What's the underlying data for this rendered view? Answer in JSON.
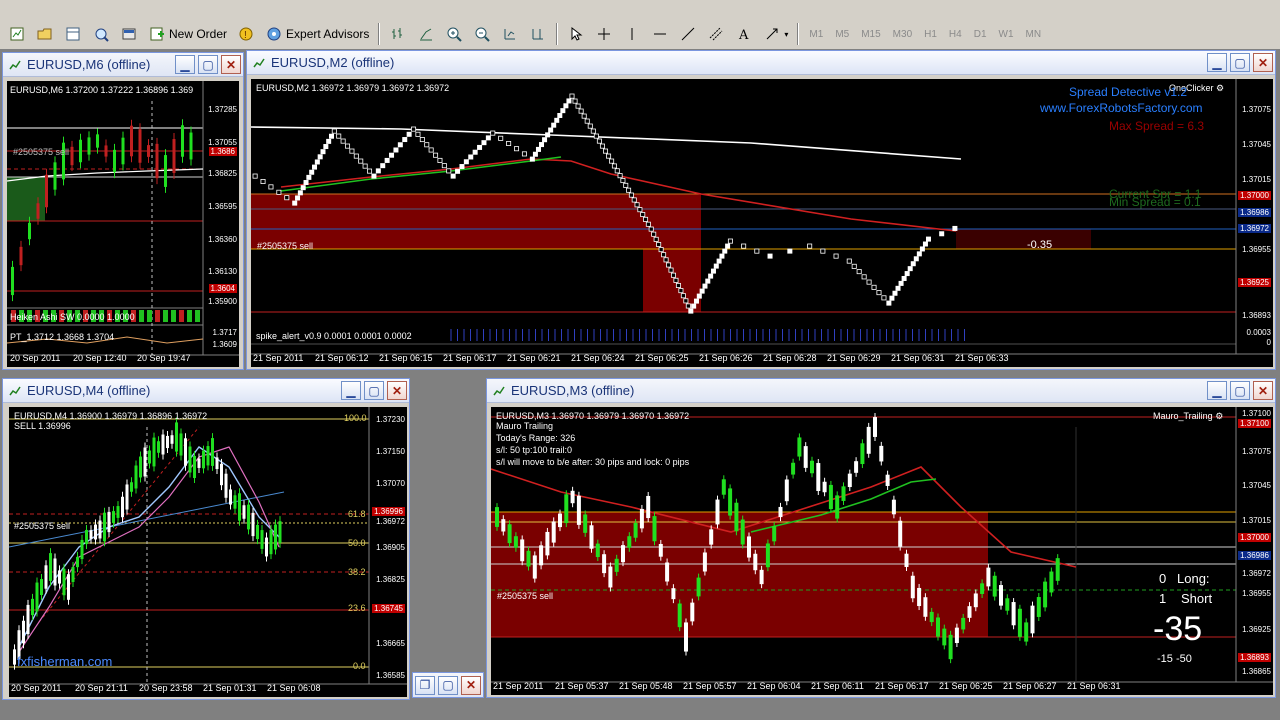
{
  "toolbar": {
    "new_order": "New Order",
    "expert_advisors": "Expert Advisors",
    "timeframes": [
      "M1",
      "M5",
      "M15",
      "M30",
      "H1",
      "H4",
      "D1",
      "W1",
      "MN"
    ]
  },
  "windows": {
    "m6": {
      "title": "EURUSD,M6 (offline)",
      "header": "EURUSD,M6  1.37200 1.37222 1.36896 1.369",
      "order": "#2505375 sell",
      "indicator1": "Heiken Ashi SW 0.0000 1.0000",
      "indicator2": "PT_1.3712 1.3668 1.3704",
      "prices": [
        "1.37285",
        "1.37055",
        "1.3686",
        "1.36825",
        "1.36595",
        "1.36360",
        "1.36130",
        "1.3604",
        "1.35900",
        "1.3717",
        "1.3609"
      ],
      "dates": [
        "20 Sep 2011",
        "20 Sep 12:40",
        "20 Sep 19:47"
      ]
    },
    "m2": {
      "title": "EURUSD,M2 (offline)",
      "header": "EURUSD,M2  1.36972 1.36979 1.36972 1.36972",
      "order": "#2505375 sell",
      "indicator": "spike_alert_v0.9 0.0001 0.0001 0.0002",
      "oneclicker": "OneClicker",
      "spread_title": "Spread Detective v1.2",
      "spread_url": "www.ForexRobotsFactory.com",
      "max_spread": "Max Spread = 6.3",
      "current_spr": "Current Spr = 1.1",
      "min_spread": "Min Spread = 0.1",
      "pnl": "-0.35",
      "prices": [
        "1.37075",
        "1.37045",
        "1.37015",
        "1.37000",
        "1.36986",
        "1.36972",
        "1.36955",
        "1.36925",
        "1.36893",
        "0.0003",
        "0"
      ],
      "dates": [
        "21 Sep 2011",
        "21 Sep 06:12",
        "21 Sep 06:15",
        "21 Sep 06:17",
        "21 Sep 06:21",
        "21 Sep 06:24",
        "21 Sep 06:25",
        "21 Sep 06:26",
        "21 Sep 06:28",
        "21 Sep 06:29",
        "21 Sep 06:31",
        "21 Sep 06:33"
      ]
    },
    "m4": {
      "title": "EURUSD,M4 (offline)",
      "header": "EURUSD,M4  1.36900 1.36979 1.36896 1.36972",
      "sell": "SELL  1.36996",
      "order": "#2505375 sell",
      "watermark": "fxfisherman.com",
      "fib": [
        "100.0",
        "61.8",
        "50.0",
        "38.2",
        "23.6",
        "0.0"
      ],
      "prices": [
        "1.37230",
        "1.37150",
        "1.37070",
        "1.36972",
        "1.36905",
        "1.36825",
        "1.36745",
        "1.36665",
        "1.36585",
        "1.36996"
      ],
      "dates": [
        "20 Sep 2011",
        "20 Sep 21:11",
        "20 Sep 23:58",
        "21 Sep 01:31",
        "21 Sep 06:08"
      ]
    },
    "m3": {
      "title": "EURUSD,M3 (offline)",
      "header": "EURUSD,M3  1.36970 1.36979 1.36970 1.36972",
      "indicator_name": "Mauro_Trailing",
      "info1": "Mauro Trailing",
      "info2": "Today's Range: 326",
      "info3": "s/l: 50  tp:100  trail:0",
      "info4": "s/l will move to b/e after: 30 pips   and lock: 0 pips",
      "order": "#2505375 sell",
      "long_count": "0",
      "long_label": "Long:",
      "short_count": "1",
      "short_label": "Short",
      "big": "-35",
      "small": "-15   -50",
      "prices": [
        "1.37100",
        "1.37075",
        "1.37045",
        "1.37015",
        "1.37000",
        "1.36986",
        "1.36972",
        "1.36955",
        "1.36925",
        "1.36893",
        "1.36865"
      ],
      "dates": [
        "21 Sep 2011",
        "21 Sep 05:37",
        "21 Sep 05:48",
        "21 Sep 05:57",
        "21 Sep 06:04",
        "21 Sep 06:11",
        "21 Sep 06:17",
        "21 Sep 06:25",
        "21 Sep 06:27",
        "21 Sep 06:31"
      ]
    }
  }
}
